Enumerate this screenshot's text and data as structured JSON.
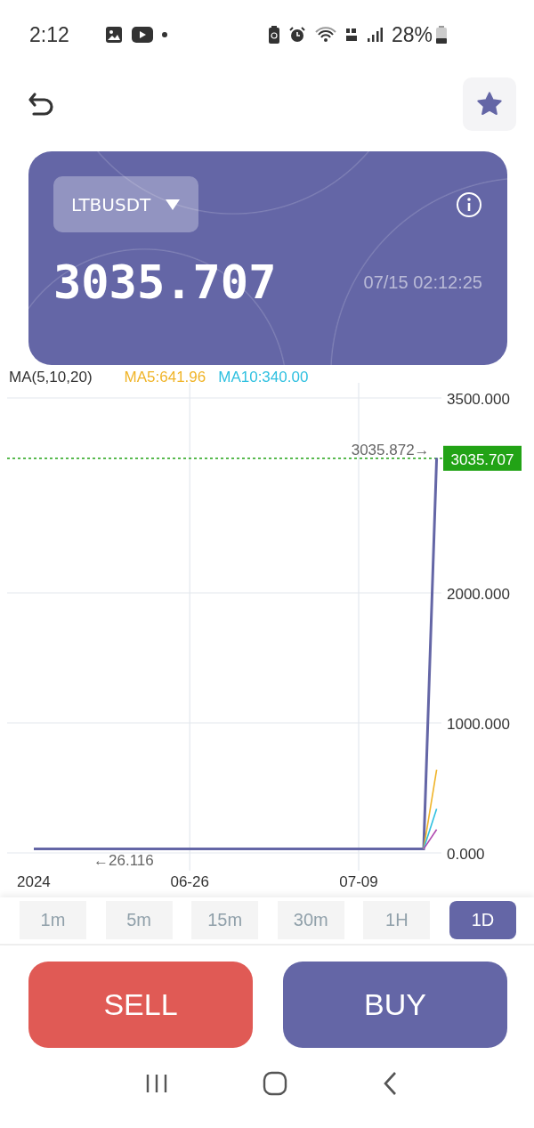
{
  "status_bar": {
    "time": "2:12",
    "battery": "28%"
  },
  "ticker": {
    "symbol": "LTBUSDT",
    "price": "3035.707",
    "timestamp": "07/15 02:12:25"
  },
  "legend": {
    "label": "MA(5,10,20)",
    "items": [
      {
        "text": "MA5:641.96",
        "color": "#f0b429"
      },
      {
        "text": "MA10:340.00",
        "color": "#2fc0e0"
      }
    ]
  },
  "chart_data": {
    "type": "line",
    "categories": [
      "2024",
      null,
      null,
      null,
      null,
      null,
      null,
      null,
      null,
      null,
      null,
      null,
      "06-26",
      null,
      null,
      null,
      null,
      null,
      null,
      null,
      null,
      null,
      null,
      null,
      null,
      "07-09",
      null,
      null,
      null,
      null,
      null,
      null
    ],
    "series": [
      {
        "color": "#6466a6",
        "values": [
          30,
          30,
          30,
          30,
          30,
          30,
          30,
          30,
          30,
          30,
          30,
          30,
          30,
          30,
          30,
          30,
          30,
          30,
          30,
          30,
          30,
          30,
          30,
          30,
          30,
          30,
          30,
          30,
          30,
          30,
          30,
          3040
        ]
      },
      {
        "color": "#f0b429",
        "values": [
          null,
          null,
          null,
          null,
          null,
          null,
          null,
          null,
          null,
          null,
          null,
          null,
          null,
          null,
          null,
          null,
          null,
          null,
          null,
          null,
          null,
          null,
          null,
          null,
          null,
          null,
          null,
          null,
          null,
          null,
          30,
          640
        ]
      },
      {
        "color": "#2fc0e0",
        "values": [
          null,
          null,
          null,
          null,
          null,
          null,
          null,
          null,
          null,
          null,
          null,
          null,
          null,
          null,
          null,
          null,
          null,
          null,
          null,
          null,
          null,
          null,
          null,
          null,
          null,
          null,
          null,
          null,
          null,
          null,
          30,
          340
        ]
      },
      {
        "color": "#b04ab0",
        "values": [
          null,
          null,
          null,
          null,
          null,
          null,
          null,
          null,
          null,
          null,
          null,
          null,
          null,
          null,
          null,
          null,
          null,
          null,
          null,
          null,
          null,
          null,
          null,
          null,
          null,
          null,
          null,
          null,
          null,
          null,
          30,
          180
        ]
      }
    ],
    "ylim": [
      0,
      3500
    ],
    "yticks": [
      {
        "value": 0,
        "label": "0.000"
      },
      {
        "value": 1000,
        "label": "1000.000"
      },
      {
        "value": 2000,
        "label": "2000.000"
      },
      {
        "value": 3500,
        "label": "3500.000"
      }
    ],
    "grid": true,
    "ref_lines": [
      {
        "axis": "y",
        "value": 3035.707,
        "label": "3035.707",
        "color": "#22a316"
      }
    ],
    "annotations": [
      "3035.872→",
      "←26.116"
    ]
  },
  "intervals": [
    {
      "label": "1m",
      "selected": false
    },
    {
      "label": "5m",
      "selected": false
    },
    {
      "label": "15m",
      "selected": false
    },
    {
      "label": "30m",
      "selected": false
    },
    {
      "label": "1H",
      "selected": false
    },
    {
      "label": "1D",
      "selected": true
    }
  ],
  "actions": [
    {
      "kind": "sell",
      "label": "SELL"
    },
    {
      "kind": "buy",
      "label": "BUY"
    }
  ]
}
